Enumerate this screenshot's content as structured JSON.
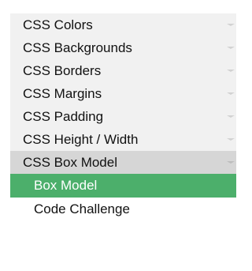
{
  "menu": {
    "items": [
      {
        "label": "CSS Colors",
        "icon": "chevron-down-icon"
      },
      {
        "label": "CSS Backgrounds",
        "icon": "chevron-down-icon"
      },
      {
        "label": "CSS Borders",
        "icon": "chevron-down-icon"
      },
      {
        "label": "CSS Margins",
        "icon": "chevron-down-icon"
      },
      {
        "label": "CSS Padding",
        "icon": "chevron-down-icon"
      },
      {
        "label": "CSS Height / Width",
        "icon": "chevron-down-icon"
      },
      {
        "label": "CSS Box Model",
        "icon": "chevron-down-icon",
        "active": true
      }
    ],
    "subitems": [
      {
        "label": "Box Model",
        "selected": true
      },
      {
        "label": "Code Challenge"
      }
    ]
  },
  "colors": {
    "item_bg": "#f1f1f1",
    "active_bg": "#d6d6d6",
    "selected_bg": "#4caf6b",
    "selected_text": "#ffffff"
  }
}
